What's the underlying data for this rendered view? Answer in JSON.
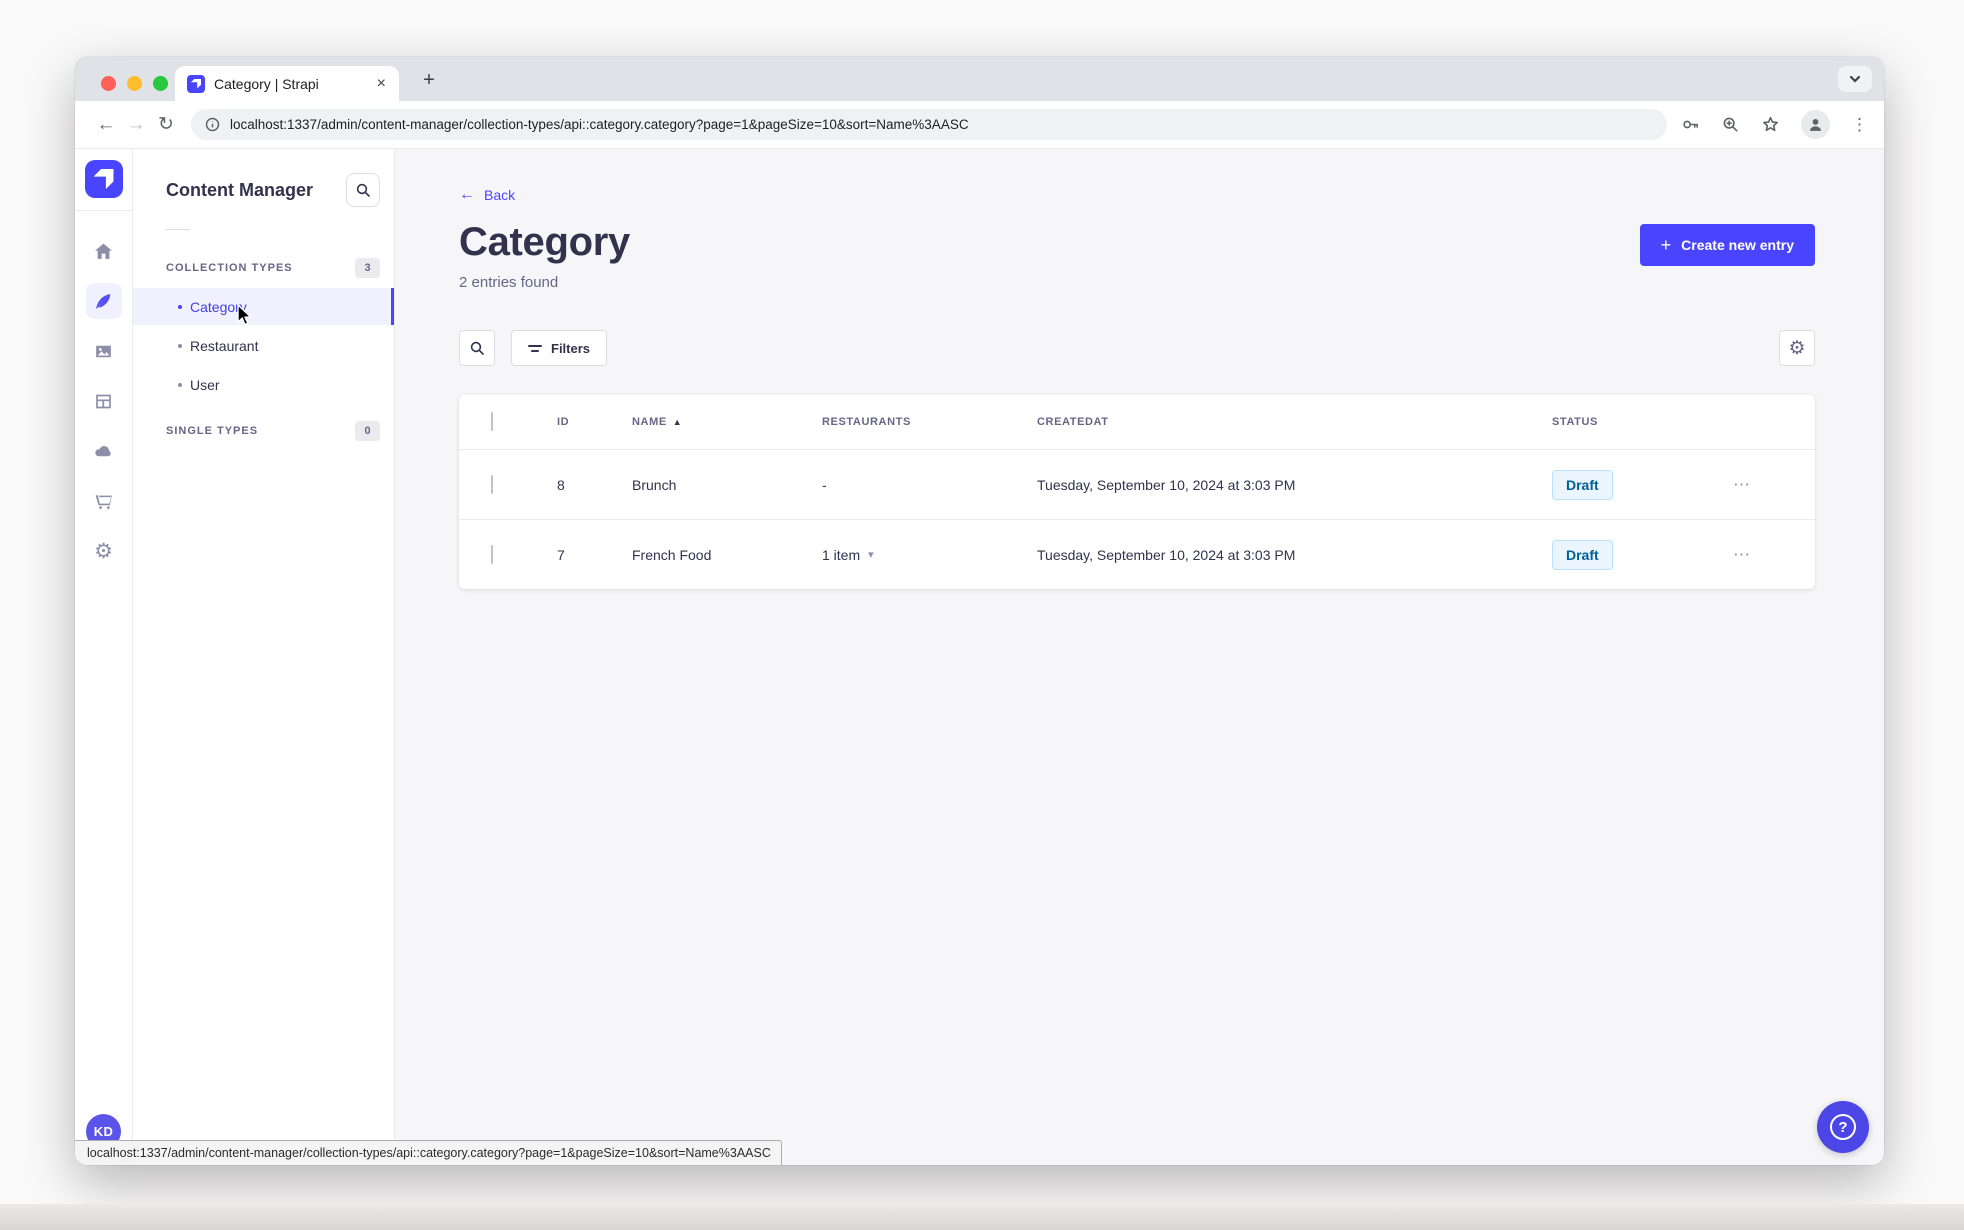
{
  "browser": {
    "tab_title": "Category | Strapi",
    "url": "localhost:1337/admin/content-manager/collection-types/api::category.category?page=1&pageSize=10&sort=Name%3AASC",
    "status_url": "localhost:1337/admin/content-manager/collection-types/api::category.category?page=1&pageSize=10&sort=Name%3AASC",
    "icons": {
      "close": "×",
      "plus": "+",
      "back": "←",
      "forward": "→",
      "reload": "↻",
      "star": "☆",
      "menu_dots": "⋮"
    }
  },
  "rail": {
    "avatar_initials": "KD",
    "gear_glyph": "⚙"
  },
  "subnav": {
    "title": "Content Manager",
    "collection_types": {
      "label": "COLLECTION TYPES",
      "count": "3"
    },
    "items": [
      {
        "label": "Category"
      },
      {
        "label": "Restaurant"
      },
      {
        "label": "User"
      }
    ],
    "single_types": {
      "label": "SINGLE TYPES",
      "count": "0"
    }
  },
  "main": {
    "back_label": "Back",
    "back_arrow": "←",
    "title": "Category",
    "subtitle": "2 entries found",
    "create_button": {
      "label": "Create new entry",
      "plus": "+"
    },
    "filters_button": "Filters",
    "gear_glyph": "⚙",
    "table": {
      "headers": [
        "ID",
        "NAME",
        "RESTAURANTS",
        "CREATEDAT",
        "STATUS"
      ],
      "sort_asc_glyph": "▲",
      "chevron_down_glyph": "▾",
      "row_menu_glyph": "⋯",
      "rows": [
        {
          "id": "8",
          "name": "Brunch",
          "restaurants": "-",
          "created_at": "Tuesday, September 10, 2024 at 3:03 PM",
          "status": "Draft"
        },
        {
          "id": "7",
          "name": "French Food",
          "restaurants": "1 item",
          "created_at": "Tuesday, September 10, 2024 at 3:03 PM",
          "status": "Draft"
        }
      ]
    },
    "help_glyph": "?"
  },
  "colors": {
    "accent": "#4945FF",
    "active_bg": "#F0F0FF",
    "main_bg": "#F6F6F9",
    "text_primary": "#32324D",
    "text_secondary": "#666687",
    "badge_draft_bg": "#EAF5FF",
    "badge_draft_border": "#B8E1FF",
    "badge_draft_text": "#006096"
  }
}
